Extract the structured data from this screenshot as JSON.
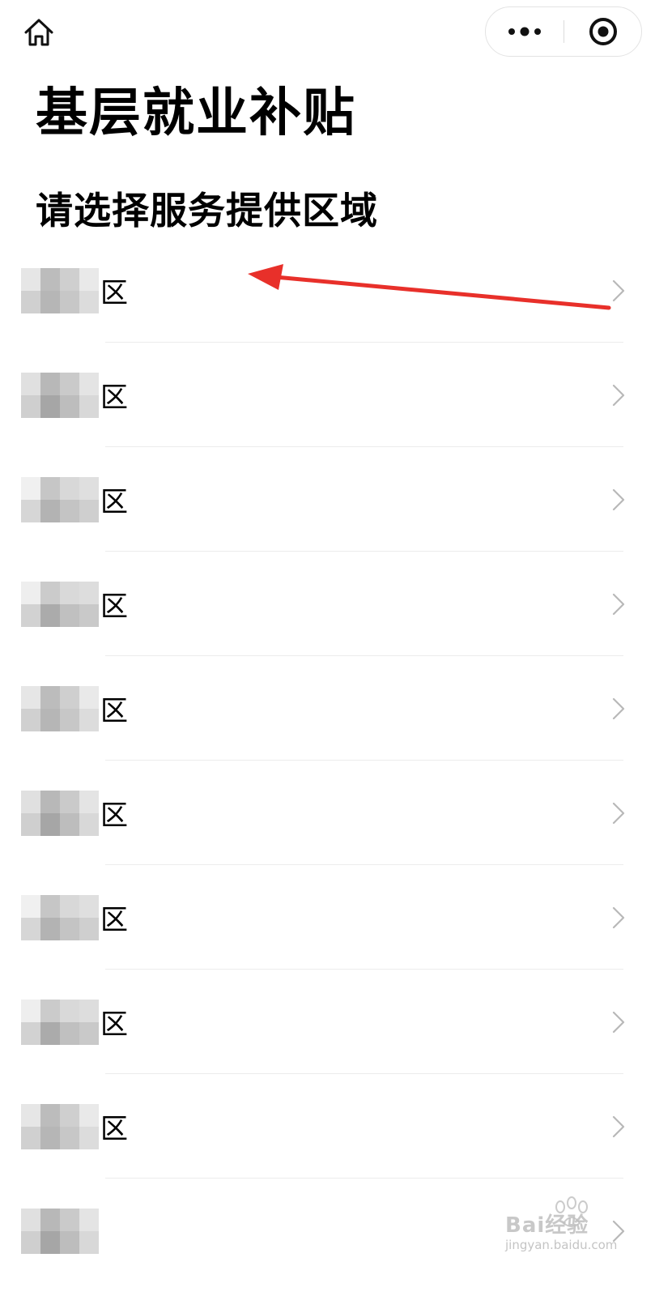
{
  "nav": {
    "home_icon": "home-icon",
    "more_icon": "more-dots-icon",
    "close_icon": "target-close-icon"
  },
  "page": {
    "title": "基层就业补贴",
    "subtitle": "请选择服务提供区域"
  },
  "regions": [
    {
      "label": "区"
    },
    {
      "label": "区"
    },
    {
      "label": "区"
    },
    {
      "label": "区"
    },
    {
      "label": "区"
    },
    {
      "label": "区"
    },
    {
      "label": "区"
    },
    {
      "label": "区"
    },
    {
      "label": "区"
    },
    {
      "label": ""
    }
  ],
  "watermark": {
    "brand": "Bai经验",
    "url": "jingyan.baidu.com"
  },
  "colors": {
    "annotation_arrow": "#e8302a",
    "chevron": "#b8b8b8",
    "separator": "#ececec"
  }
}
